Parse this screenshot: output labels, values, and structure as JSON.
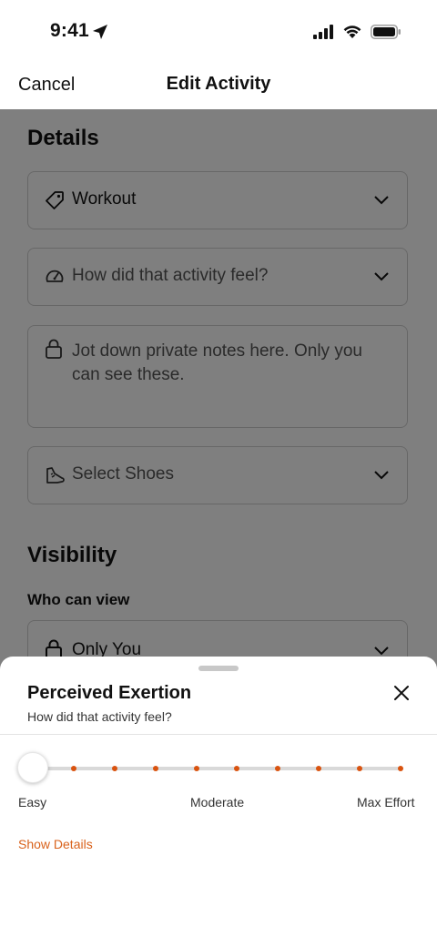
{
  "status_bar": {
    "time": "9:41"
  },
  "nav": {
    "cancel_label": "Cancel",
    "title": "Edit Activity"
  },
  "details": {
    "section_title": "Details",
    "activity_type": "Workout",
    "feel_placeholder": "How did that activity feel?",
    "notes_placeholder": "Jot down private notes here. Only you can see these.",
    "shoes_placeholder": "Select Shoes"
  },
  "visibility": {
    "section_title": "Visibility",
    "who_can_view_label": "Who can view",
    "who_can_view_value": "Only You"
  },
  "sheet": {
    "title": "Perceived Exertion",
    "subtitle": "How did that activity feel?",
    "slider": {
      "value": 1,
      "steps": 10
    },
    "labels": {
      "easy": "Easy",
      "moderate": "Moderate",
      "max": "Max Effort"
    },
    "show_details_label": "Show Details"
  },
  "colors": {
    "accent": "#d9621b",
    "tick": "#d9530f",
    "overlay": "rgba(0,0,0,0.5)"
  }
}
